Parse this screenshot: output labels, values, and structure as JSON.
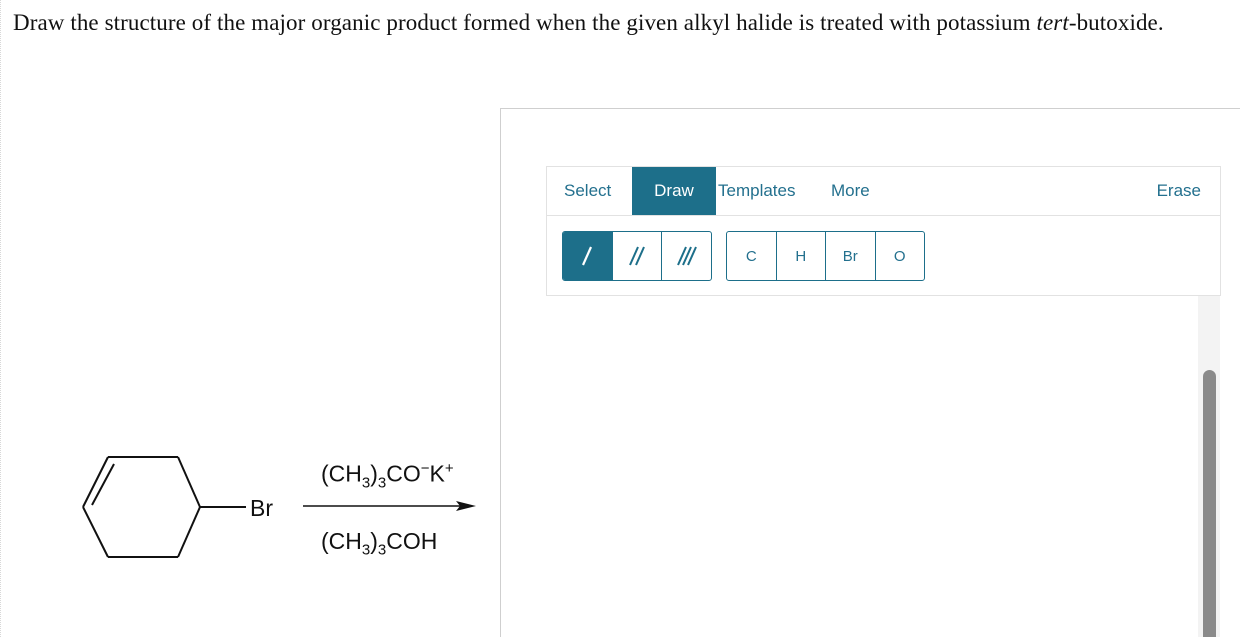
{
  "question": {
    "part1": "Draw the structure of the major organic product formed when the given alkyl halide is treated with potassium ",
    "italic": "tert",
    "part2": "-butoxide."
  },
  "reaction": {
    "substituent": "Br",
    "reagent_top": {
      "a": "(CH",
      "b": "3",
      "c": ")",
      "d": "3",
      "e": "CO",
      "f": "−",
      "g": "K",
      "h": "+"
    },
    "reagent_bottom": {
      "a": "(CH",
      "b": "3",
      "c": ")",
      "d": "3",
      "e": "COH"
    }
  },
  "sketcher": {
    "menu": {
      "select": "Select",
      "draw": "Draw",
      "templates": "Templates",
      "more": "More",
      "erase": "Erase"
    },
    "bond_tools": [
      {
        "name": "single-bond-icon",
        "active": true
      },
      {
        "name": "double-bond-icon",
        "active": false
      },
      {
        "name": "triple-bond-icon",
        "active": false
      }
    ],
    "atoms": [
      "C",
      "H",
      "Br",
      "O"
    ],
    "colors": {
      "accent": "#1d6f8a",
      "text_accent": "#23708e"
    }
  }
}
